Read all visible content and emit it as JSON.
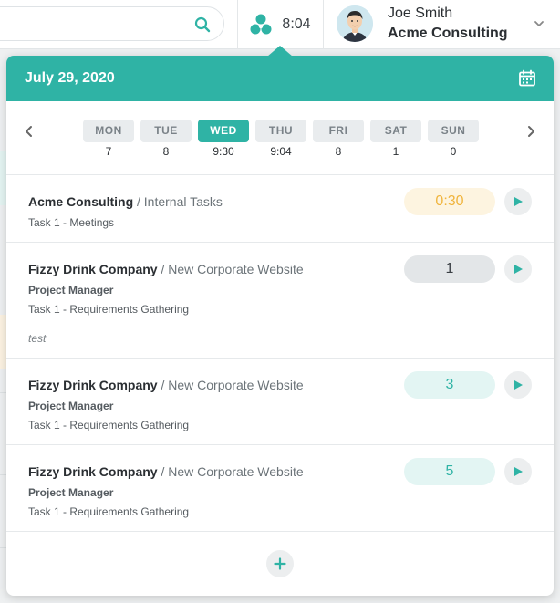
{
  "topbar": {
    "timer_value": "8:04",
    "user": {
      "name": "Joe Smith",
      "company": "Acme Consulting"
    }
  },
  "popover": {
    "date": "July 29, 2020",
    "days": [
      {
        "label": "MON",
        "total": "7",
        "active": false
      },
      {
        "label": "TUE",
        "total": "8",
        "active": false
      },
      {
        "label": "WED",
        "total": "9:30",
        "active": true
      },
      {
        "label": "THU",
        "total": "9:04",
        "active": false
      },
      {
        "label": "FRI",
        "total": "8",
        "active": false
      },
      {
        "label": "SAT",
        "total": "1",
        "active": false
      },
      {
        "label": "SUN",
        "total": "0",
        "active": false
      }
    ],
    "entries": [
      {
        "client": "Acme Consulting",
        "project": "/ Internal Tasks",
        "role": "",
        "task": "Task 1 - Meetings",
        "note": "",
        "duration": "0:30"
      },
      {
        "client": "Fizzy Drink Company",
        "project": "/ New Corporate Website",
        "role": "Project Manager",
        "task": "Task 1 - Requirements Gathering",
        "note": "test",
        "duration": "1"
      },
      {
        "client": "Fizzy Drink Company",
        "project": "/ New Corporate Website",
        "role": "Project Manager",
        "task": "Task 1 - Requirements Gathering",
        "note": "",
        "duration": "3"
      },
      {
        "client": "Fizzy Drink Company",
        "project": "/ New Corporate Website",
        "role": "Project Manager",
        "task": "Task 1 - Requirements Gathering",
        "note": "",
        "duration": "5"
      }
    ]
  },
  "icons": {
    "search": "search-icon",
    "timer": "timer-logo-icon",
    "calendar": "calendar-icon",
    "prev": "chevron-left-icon",
    "next": "chevron-right-icon",
    "play": "play-icon",
    "add": "plus-icon",
    "dropdown": "chevron-down-icon"
  },
  "colors": {
    "accent": "#2fb3a5",
    "running_bg": "#fdf4e0",
    "running_text": "#f0b43c",
    "neutral_bg": "#e3e6e8",
    "light_accent_bg": "#e3f5f3"
  }
}
